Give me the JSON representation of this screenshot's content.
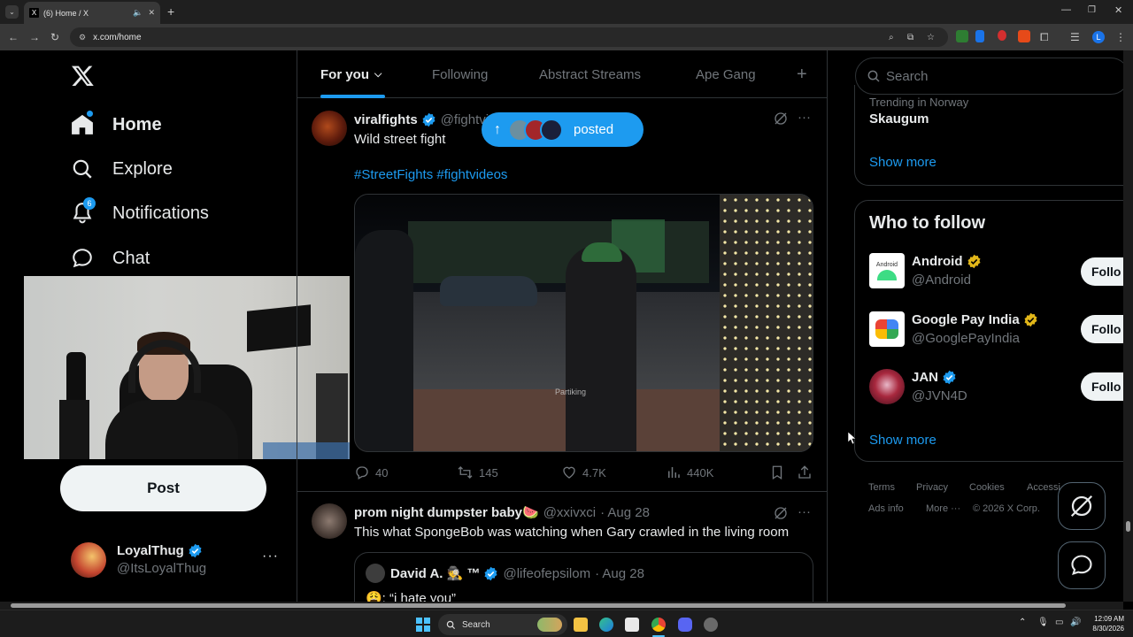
{
  "browser": {
    "tab_title": "(6) Home / X",
    "tab_favicon": "X",
    "url": "x.com/home"
  },
  "nav": {
    "items": [
      {
        "label": "Home",
        "icon": "home-icon"
      },
      {
        "label": "Explore",
        "icon": "search-icon"
      },
      {
        "label": "Notifications",
        "icon": "bell-icon",
        "badge": "6"
      },
      {
        "label": "Chat",
        "icon": "chat-icon"
      }
    ],
    "post_label": "Post",
    "profile": {
      "name": "LoyalThug",
      "handle": "@ItsLoyalThug"
    }
  },
  "feed_tabs": [
    "For you",
    "Following",
    "Abstract Streams",
    "Ape Gang"
  ],
  "new_posts_pill": {
    "label": "posted"
  },
  "tweets": [
    {
      "name": "viralfights",
      "handle": "@fightvi",
      "text": "Wild street fight",
      "hashtags": "#StreetFights #fightvideos",
      "watermark": "Partiking",
      "actions": {
        "replies": "40",
        "reposts": "145",
        "likes": "4.7K",
        "views": "440K"
      }
    },
    {
      "name": "prom night dumpster baby🍉",
      "handle": "@xxivxci",
      "date": "· Aug 28",
      "text": "This what SpongeBob was watching when Gary crawled in the living room",
      "quote": {
        "name": "David A. 🕵 ™",
        "handle": "@lifeofepsilom",
        "date": "· Aug 28",
        "text": "😩: “i hate you”"
      }
    }
  ],
  "search": {
    "placeholder": "Search"
  },
  "trending": {
    "context": "Trending in Norway",
    "topic": "Skaugum",
    "show_more": "Show more"
  },
  "who_to_follow": {
    "title": "Who to follow",
    "follow_label": "Follo",
    "accounts": [
      {
        "name": "Android",
        "handle": "@Android",
        "badge": "gold"
      },
      {
        "name": "Google Pay India",
        "handle": "@GooglePayIndia",
        "badge": "gold"
      },
      {
        "name": "JAN",
        "handle": "@JVN4D",
        "badge": "blue"
      }
    ],
    "show_more": "Show more"
  },
  "footer": {
    "links": [
      "Terms",
      "Privacy",
      "Cookies",
      "Accessi",
      "Ads info",
      "More ···"
    ],
    "copyright": "© 2026 X Corp."
  },
  "taskbar": {
    "search": "Search",
    "time": "12:09 AM",
    "date": "8/30/2026"
  },
  "colors": {
    "accent": "#1d9bf0",
    "verified_gold": "#e2b719",
    "background": "#000000"
  }
}
